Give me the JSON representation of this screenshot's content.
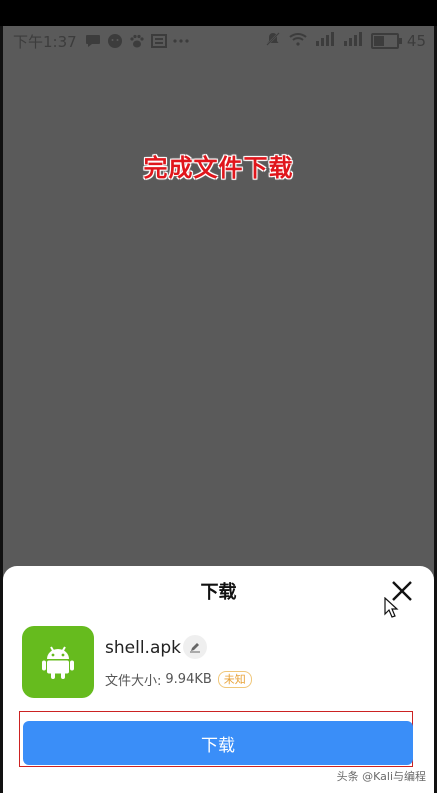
{
  "status_bar": {
    "time": "下午1:37",
    "battery": "45",
    "battery_level": 0.45,
    "left_icons": [
      "chat-bubble-icon",
      "messenger-icon",
      "paw-icon",
      "photo-icon",
      "more-dots-icon"
    ],
    "right_icons": [
      "mute-icon",
      "wifi-icon",
      "signal-icon",
      "signal-icon",
      "battery-icon"
    ]
  },
  "caption": "完成文件下载",
  "sheet": {
    "title": "下载",
    "file_name": "shell.apk",
    "size_label": "文件大小:",
    "size_value": "9.94KB",
    "badge": "未知",
    "download_label": "下载",
    "app_icon": "android-icon"
  },
  "watermark": "头条 @Kali与编程",
  "colors": {
    "accent": "#3a8ef8",
    "app_icon_bg": "#66bb1e",
    "caption": "#e0161c",
    "badge": "#e8a237"
  }
}
